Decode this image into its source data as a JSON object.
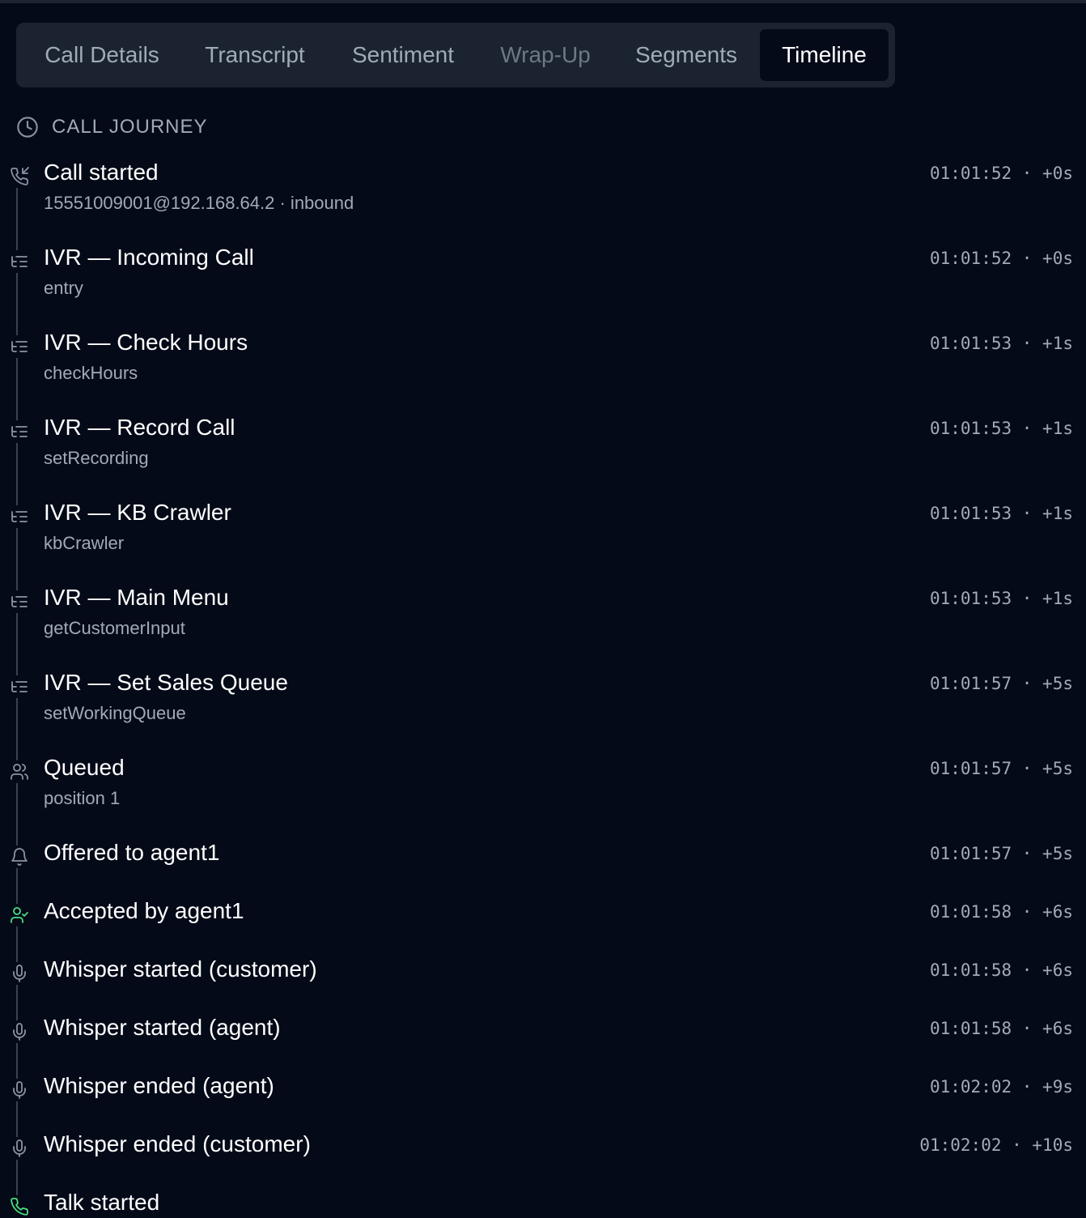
{
  "tabs": [
    {
      "label": "Call Details"
    },
    {
      "label": "Transcript"
    },
    {
      "label": "Sentiment"
    },
    {
      "label": "Wrap-Up"
    },
    {
      "label": "Segments"
    },
    {
      "label": "Timeline"
    }
  ],
  "active_tab": "Timeline",
  "disabled_tab": "Wrap-Up",
  "section": {
    "title": "CALL JOURNEY",
    "icon": "clock-icon"
  },
  "events": [
    {
      "title": "Call started",
      "sub": "15551009001@192.168.64.2 · inbound",
      "time": "01:01:52 · +0s",
      "icon": "phone-incoming-icon"
    },
    {
      "title": "IVR — Incoming Call",
      "sub": "entry",
      "time": "01:01:52 · +0s",
      "icon": "list-tree-icon"
    },
    {
      "title": "IVR — Check Hours",
      "sub": "checkHours",
      "time": "01:01:53 · +1s",
      "icon": "list-tree-icon"
    },
    {
      "title": "IVR — Record Call",
      "sub": "setRecording",
      "time": "01:01:53 · +1s",
      "icon": "list-tree-icon"
    },
    {
      "title": "IVR — KB Crawler",
      "sub": "kbCrawler",
      "time": "01:01:53 · +1s",
      "icon": "list-tree-icon"
    },
    {
      "title": "IVR — Main Menu",
      "sub": "getCustomerInput",
      "time": "01:01:53 · +1s",
      "icon": "list-tree-icon"
    },
    {
      "title": "IVR — Set Sales Queue",
      "sub": "setWorkingQueue",
      "time": "01:01:57 · +5s",
      "icon": "list-tree-icon"
    },
    {
      "title": "Queued",
      "sub": "position 1",
      "time": "01:01:57 · +5s",
      "icon": "users-icon"
    },
    {
      "title": "Offered to agent1",
      "sub": "",
      "time": "01:01:57 · +5s",
      "icon": "bell-icon"
    },
    {
      "title": "Accepted by agent1",
      "sub": "",
      "time": "01:01:58 · +6s",
      "icon": "user-check-icon"
    },
    {
      "title": "Whisper started (customer)",
      "sub": "",
      "time": "01:01:58 · +6s",
      "icon": "microphone-icon"
    },
    {
      "title": "Whisper started (agent)",
      "sub": "",
      "time": "01:01:58 · +6s",
      "icon": "microphone-icon"
    },
    {
      "title": "Whisper ended (agent)",
      "sub": "",
      "time": "01:02:02 · +9s",
      "icon": "microphone-icon"
    },
    {
      "title": "Whisper ended (customer)",
      "sub": "",
      "time": "01:02:02 · +10s",
      "icon": "microphone-icon"
    },
    {
      "title": "Talk started",
      "sub": "",
      "time": "",
      "icon": "phone-call-icon"
    }
  ],
  "colors": {
    "background": "#050a18",
    "tabbar": "#1c2330",
    "text": "#ffffff",
    "muted": "#a0aab8",
    "icon": "#8a93a3",
    "accent_green": "#4ade80"
  }
}
